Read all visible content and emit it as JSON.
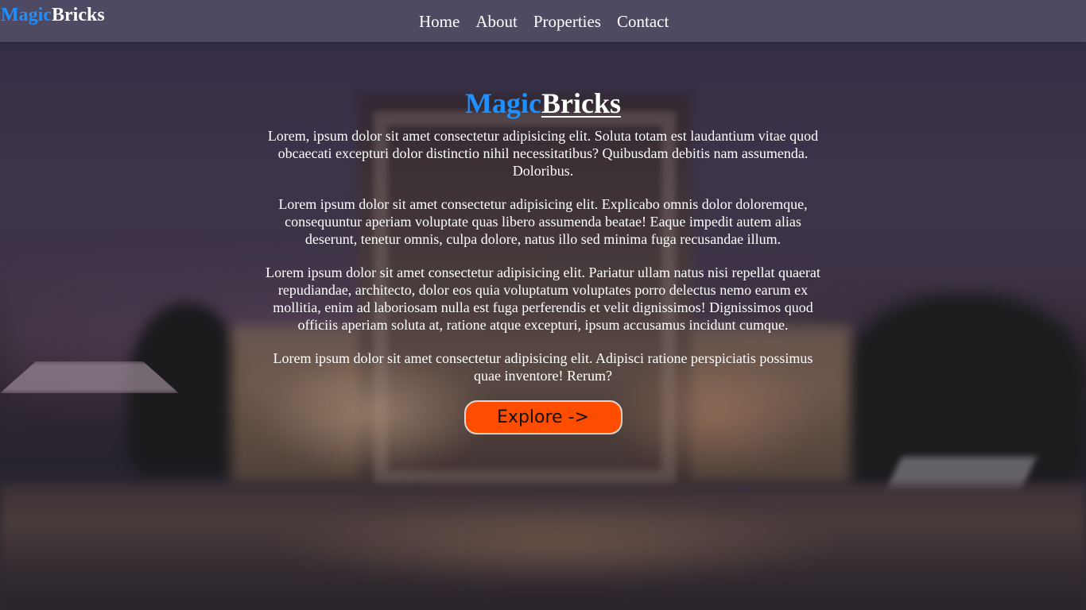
{
  "brand": {
    "part1": "Magic",
    "part2": "Bricks"
  },
  "nav": {
    "items": [
      "Home",
      "About",
      "Properties",
      "Contact"
    ]
  },
  "hero": {
    "title_part1": "Magic",
    "title_part2": "Bricks",
    "paragraphs": [
      "Lorem, ipsum dolor sit amet consectetur adipisicing elit. Soluta totam est laudantium vitae quod obcaecati excepturi dolor distinctio nihil necessitatibus? Quibusdam debitis nam assumenda. Doloribus.",
      "Lorem ipsum dolor sit amet consectetur adipisicing elit. Explicabo omnis dolor doloremque, consequuntur aperiam voluptate quas libero assumenda beatae! Eaque impedit autem alias deserunt, tenetur omnis, culpa dolore, natus illo sed minima fuga recusandae illum.",
      "Lorem ipsum dolor sit amet consectetur adipisicing elit. Pariatur ullam natus nisi repellat quaerat repudiandae, architecto, dolor eos quia voluptatum voluptates porro delectus nemo earum ex mollitia, enim ad laboriosam nulla est fuga perferendis et velit dignissimos! Dignissimos quod officiis aperiam soluta at, ratione atque excepturi, ipsum accusamus incidunt cumque.",
      "Lorem ipsum dolor sit amet consectetur adipisicing elit. Adipisci ratione perspiciatis possimus quae inventore! Rerum?"
    ],
    "button_label": "Explore ->"
  },
  "colors": {
    "brand_blue": "#1e90ff",
    "button_orange": "#ff4d00",
    "navbar_bg": "#5a556e"
  }
}
